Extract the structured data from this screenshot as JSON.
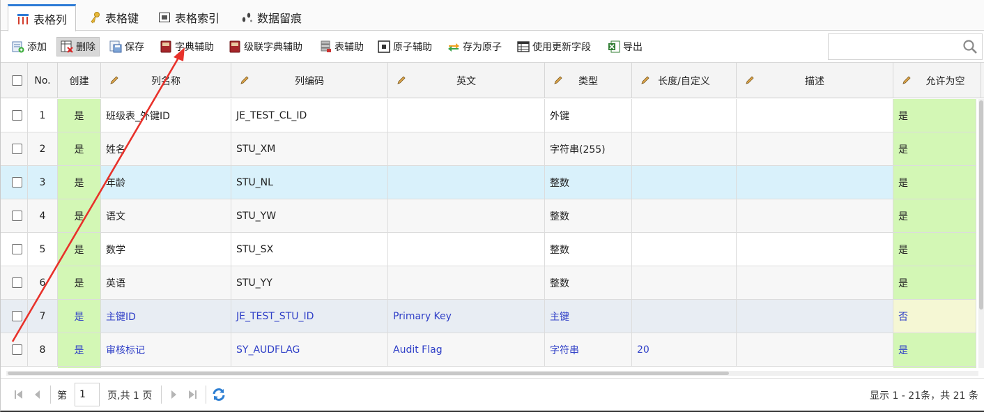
{
  "tabs": [
    {
      "label": "表格列",
      "icon": "columns-icon",
      "active": true
    },
    {
      "label": "表格键",
      "icon": "key-icon",
      "active": false
    },
    {
      "label": "表格索引",
      "icon": "index-icon",
      "active": false
    },
    {
      "label": "数据留痕",
      "icon": "footprints-icon",
      "active": false
    }
  ],
  "toolbar": {
    "add": "添加",
    "delete": "删除",
    "save": "保存",
    "dict_helper": "字典辅助",
    "cascade_dict_helper": "级联字典辅助",
    "table_helper": "表辅助",
    "atom_helper": "原子辅助",
    "save_as_atom": "存为原子",
    "use_update_fields": "使用更新字段",
    "export": "导出"
  },
  "search": {
    "placeholder": "",
    "value": ""
  },
  "columns": {
    "no": "No.",
    "create": "创建",
    "name": "列名称",
    "code": "列编码",
    "english": "英文",
    "type": "类型",
    "length": "长度/自定义",
    "desc": "描述",
    "nullable": "允许为空"
  },
  "rows": [
    {
      "no": "1",
      "create": "是",
      "name": "班级表_外键ID",
      "code": "JE_TEST_CL_ID",
      "english": "",
      "type": "外键",
      "length": "",
      "desc": "",
      "nullable": "是"
    },
    {
      "no": "2",
      "create": "是",
      "name": "姓名",
      "code": "STU_XM",
      "english": "",
      "type": "字符串(255)",
      "length": "",
      "desc": "",
      "nullable": "是"
    },
    {
      "no": "3",
      "create": "是",
      "name": "年龄",
      "code": "STU_NL",
      "english": "",
      "type": "整数",
      "length": "",
      "desc": "",
      "nullable": "是"
    },
    {
      "no": "4",
      "create": "是",
      "name": "语文",
      "code": "STU_YW",
      "english": "",
      "type": "整数",
      "length": "",
      "desc": "",
      "nullable": "是"
    },
    {
      "no": "5",
      "create": "是",
      "name": "数学",
      "code": "STU_SX",
      "english": "",
      "type": "整数",
      "length": "",
      "desc": "",
      "nullable": "是"
    },
    {
      "no": "6",
      "create": "是",
      "name": "英语",
      "code": "STU_YY",
      "english": "",
      "type": "整数",
      "length": "",
      "desc": "",
      "nullable": "是"
    },
    {
      "no": "7",
      "create": "是",
      "name": "主键ID",
      "code": "JE_TEST_STU_ID",
      "english": "Primary Key",
      "type": "主键",
      "length": "",
      "desc": "",
      "nullable": "否"
    },
    {
      "no": "8",
      "create": "是",
      "name": "审核标记",
      "code": "SY_AUDFLAG",
      "english": "Audit Flag",
      "type": "字符串",
      "length": "20",
      "desc": "",
      "nullable": "是"
    }
  ],
  "pager": {
    "page_prefix": "第",
    "page_value": "1",
    "page_suffix": "页,共 1 页",
    "summary": "显示 1 - 21条，共 21 条"
  },
  "colors": {
    "accent": "#2d7bd6",
    "green_cell": "#d3f7b5",
    "selected_row": "#d9f1fb",
    "link_text": "#2f3fc7",
    "annotation_arrow": "#e8312a"
  }
}
